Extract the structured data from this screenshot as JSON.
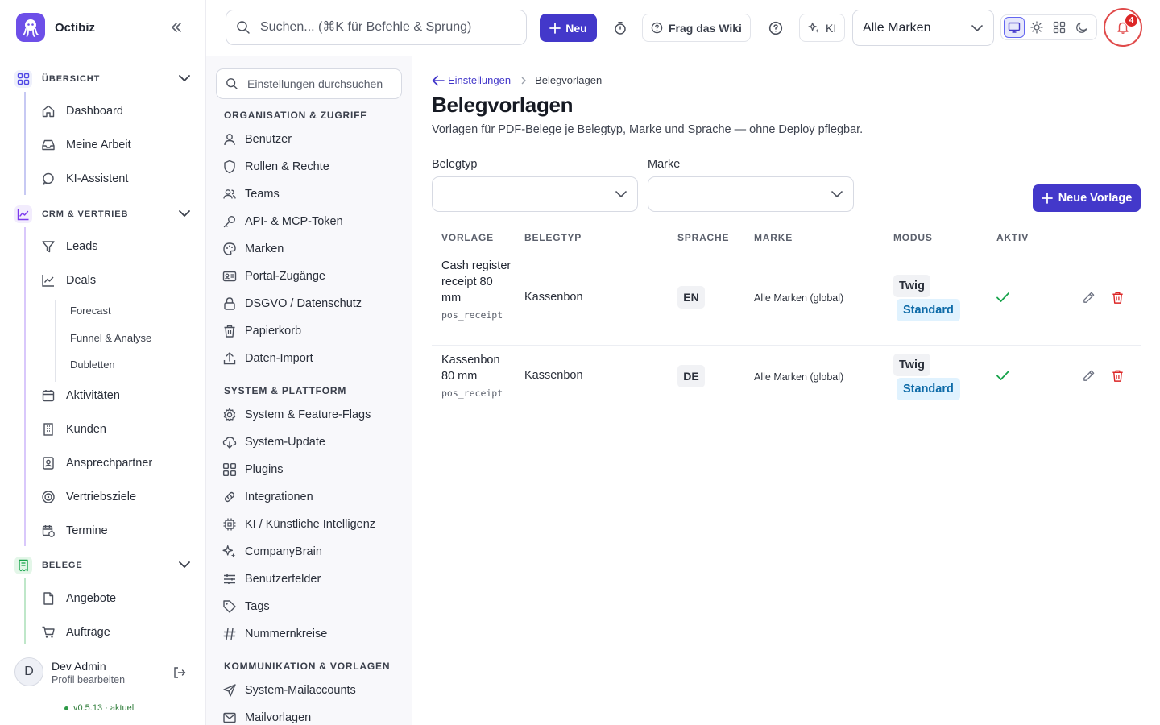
{
  "app": {
    "name": "Octibiz"
  },
  "topbar": {
    "search_placeholder": "Suchen... (⌘K für Befehle & Sprung)",
    "new_label": "Neu",
    "wiki_label": "Frag das Wiki",
    "ai_label": "KI",
    "brand_select_value": "Alle Marken",
    "notification_count": "4"
  },
  "sidebar": {
    "sections": [
      {
        "label": "ÜBERSICHT",
        "items": [
          "Dashboard",
          "Meine Arbeit",
          "KI-Assistent"
        ]
      },
      {
        "label": "CRM & VERTRIEB",
        "items": [
          "Leads",
          "Deals",
          "Aktivitäten",
          "Kunden",
          "Ansprechpartner",
          "Vertriebsziele",
          "Termine"
        ],
        "deal_subitems": [
          "Forecast",
          "Funnel & Analyse",
          "Dubletten"
        ]
      },
      {
        "label": "BELEGE",
        "items": [
          "Angebote",
          "Aufträge"
        ]
      }
    ],
    "user": {
      "initial": "D",
      "name": "Dev Admin",
      "sub": "Profil bearbeiten"
    },
    "version": "v0.5.13 · aktuell"
  },
  "settings_nav": {
    "search_placeholder": "Einstellungen durchsuchen",
    "groups": [
      {
        "label": "ORGANISATION & ZUGRIFF",
        "items": [
          "Benutzer",
          "Rollen & Rechte",
          "Teams",
          "API- & MCP-Token",
          "Marken",
          "Portal-Zugänge",
          "DSGVO / Datenschutz",
          "Papierkorb",
          "Daten-Import"
        ]
      },
      {
        "label": "SYSTEM & PLATTFORM",
        "items": [
          "System & Feature-Flags",
          "System-Update",
          "Plugins",
          "Integrationen",
          "KI / Künstliche Intelligenz",
          "CompanyBrain",
          "Benutzerfelder",
          "Tags",
          "Nummernkreise"
        ]
      },
      {
        "label": "KOMMUNIKATION & VORLAGEN",
        "items": [
          "System-Mailaccounts",
          "Mailvorlagen"
        ]
      }
    ]
  },
  "main": {
    "breadcrumb_back": "Einstellungen",
    "breadcrumb_current": "Belegvorlagen",
    "title": "Belegvorlagen",
    "subtitle": "Vorlagen für PDF-Belege je Belegtyp, Marke und Sprache — ohne Deploy pflegbar.",
    "filter_doc_type_label": "Belegtyp",
    "filter_brand_label": "Marke",
    "new_template_label": "Neue Vorlage",
    "table": {
      "headers": [
        "VORLAGE",
        "BELEGTYP",
        "SPRACHE",
        "MARKE",
        "MODUS",
        "AKTIV"
      ],
      "rows": [
        {
          "name": "Cash register receipt 80 mm",
          "key": "pos_receipt",
          "doc_type": "Kassenbon",
          "lang": "EN",
          "brand": "Alle Marken (global)",
          "mode": "Twig",
          "mode_badge": "Standard",
          "active": true
        },
        {
          "name": "Kassenbon 80 mm",
          "key": "pos_receipt",
          "doc_type": "Kassenbon",
          "lang": "DE",
          "brand": "Alle Marken (global)",
          "mode": "Twig",
          "mode_badge": "Standard",
          "active": true
        }
      ]
    }
  },
  "colors": {
    "primary": "#4338ca",
    "brand_logo": "#6d4fe8",
    "danger": "#dc2626",
    "success": "#16a34a",
    "standard_badge_bg": "#e0f2fe"
  }
}
